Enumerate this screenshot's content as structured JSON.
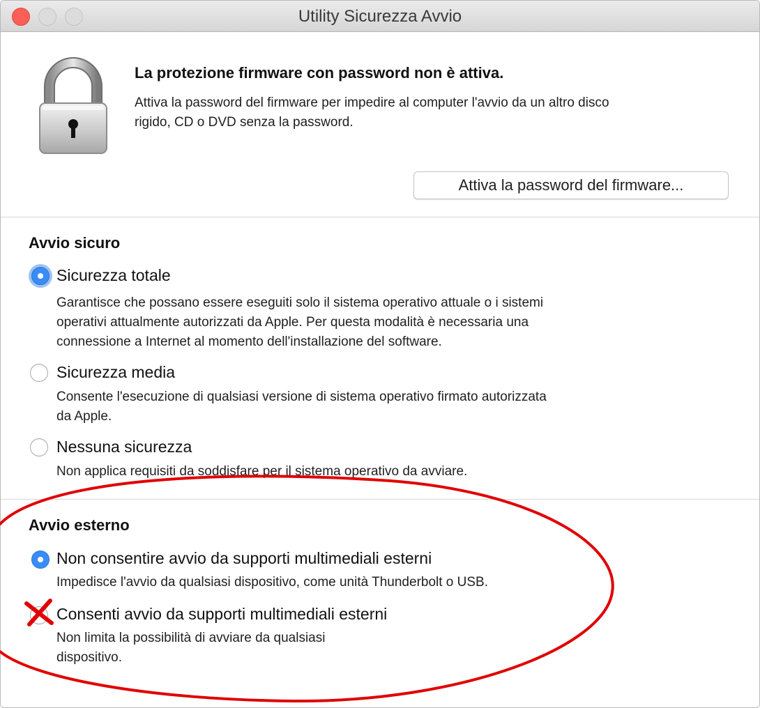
{
  "window": {
    "title": "Utility Sicurezza Avvio"
  },
  "firmware": {
    "heading": "La protezione firmware con password non è attiva.",
    "desc_line1": "Attiva la password del firmware per impedire al computer l'avvio da un altro disco",
    "desc_line2": "rigido, CD o DVD senza la password.",
    "button_label": "Attiva la password del firmware..."
  },
  "secure_boot": {
    "title": "Avvio sicuro",
    "options": [
      {
        "label": "Sicurezza totale",
        "selected": true,
        "desc": [
          "Garantisce che possano essere eseguiti solo il sistema operativo attuale o i sistemi",
          "operativi attualmente autorizzati da Apple. Per questa modalità è necessaria una",
          "connessione a Internet al momento dell'installazione del software."
        ]
      },
      {
        "label": "Sicurezza media",
        "selected": false,
        "desc": [
          "Consente l'esecuzione di qualsiasi versione di sistema operativo firmato autorizzata",
          "da Apple."
        ]
      },
      {
        "label": "Nessuna sicurezza",
        "selected": false,
        "desc": [
          "Non applica requisiti da soddisfare per il sistema operativo da avviare."
        ]
      }
    ]
  },
  "external_boot": {
    "title": "Avvio esterno",
    "options": [
      {
        "label": "Non consentire avvio da supporti multimediali esterni",
        "selected": true,
        "desc": [
          "Impedisce l'avvio da qualsiasi dispositivo, come unità Thunderbolt o USB."
        ]
      },
      {
        "label": "Consenti avvio da supporti multimediali esterni",
        "selected": false,
        "desc": [
          "Non limita la possibilità di avviare da qualsiasi",
          "dispositivo."
        ]
      }
    ]
  },
  "annotation": {
    "color": "#e00000"
  }
}
